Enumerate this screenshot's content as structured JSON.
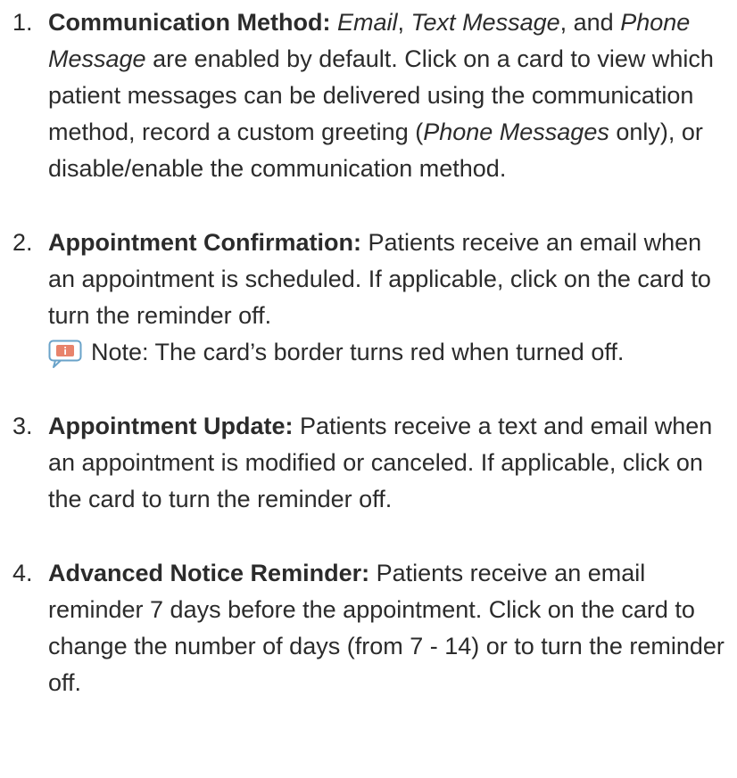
{
  "items": [
    {
      "number": "1.",
      "term": "Communication Method:",
      "parts": [
        {
          "text": " ",
          "italic": false
        },
        {
          "text": "Email",
          "italic": true
        },
        {
          "text": ", ",
          "italic": false
        },
        {
          "text": "Text Message",
          "italic": true
        },
        {
          "text": ", and ",
          "italic": false
        },
        {
          "text": "Phone Message",
          "italic": true
        },
        {
          "text": " are enabled by default. Click on a card to view which patient messages can be delivered using the communication method, record a custom greeting (",
          "italic": false
        },
        {
          "text": "Phone Messages",
          "italic": true
        },
        {
          "text": " only), or disable/enable the communication method.",
          "italic": false
        }
      ]
    },
    {
      "number": "2.",
      "term": "Appointment Confirmation:",
      "parts": [
        {
          "text": " Patients receive an email when an appointment is scheduled. If applicable, click on the card to turn the reminder off.",
          "italic": false
        }
      ],
      "note": {
        "icon": "info-note-icon",
        "text": "Note: The card’s border turns red when turned off."
      }
    },
    {
      "number": "3.",
      "term": "Appointment Update:",
      "parts": [
        {
          "text": " Patients receive a text and email when an appointment is modified or canceled. If applicable, click on the card to turn the reminder off.",
          "italic": false
        }
      ]
    },
    {
      "number": "4.",
      "term": "Advanced Notice Reminder:",
      "parts": [
        {
          "text": " Patients receive an email reminder 7 days before the appointment. Click on the card to change the number of days (from 7 - 14) or to turn the reminder off.",
          "italic": false
        }
      ]
    }
  ],
  "colors": {
    "text": "#2b2b2b",
    "note_icon_fill": "#e8836b",
    "note_icon_border": "#6aa3c9"
  }
}
